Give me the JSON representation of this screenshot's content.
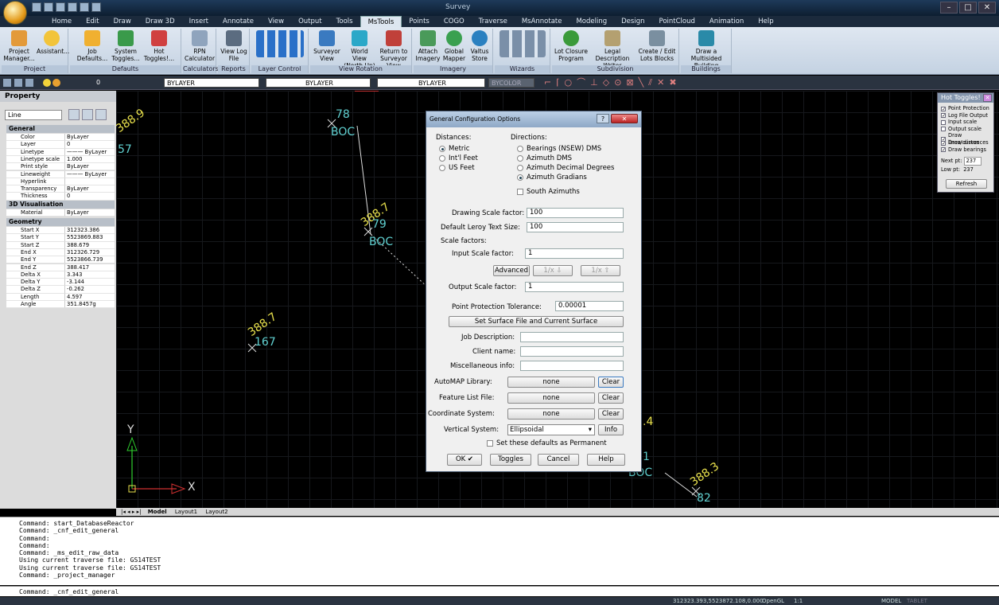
{
  "window": {
    "title": "Survey"
  },
  "ribbon_tabs": [
    "Home",
    "Edit",
    "Draw",
    "Draw 3D",
    "Insert",
    "Annotate",
    "View",
    "Output",
    "Tools",
    "MsTools",
    "Points",
    "COGO",
    "Traverse",
    "MsAnnotate",
    "Modeling",
    "Design",
    "PointCloud",
    "Animation",
    "Help"
  ],
  "ribbon_active_tab": "MsTools",
  "ribbon": {
    "project": {
      "title": "Project",
      "b1": "Project Manager...",
      "b2": "Assistant..."
    },
    "defaults": {
      "title": "Defaults",
      "b1": "Job Defaults...",
      "b2": "System Toggles...",
      "b3": "Hot Toggles!..."
    },
    "calculators": {
      "title": "Calculators",
      "b1": "RPN Calculator"
    },
    "reports": {
      "title": "Reports",
      "b1": "View Log File"
    },
    "layer": {
      "title": "Layer Control"
    },
    "viewrot": {
      "title": "View Rotation",
      "b1": "Surveyor View",
      "b2": "World View (North Up)",
      "b3": "Return to Surveyor View"
    },
    "imagery": {
      "title": "Imagery",
      "b1": "Attach Imagery",
      "b2": "Global Mapper",
      "b3": "Valtus Store"
    },
    "wizards": {
      "title": "Wizards"
    },
    "subdivision": {
      "title": "Subdivision",
      "b1": "Lot Closure Program",
      "b2": "Legal Description Writer",
      "b3": "Create / Edit Lots Blocks"
    },
    "buildings": {
      "title": "Buildings",
      "b1": "Draw a Multisided Building"
    }
  },
  "toolbar": {
    "layer": "0",
    "color": "BYLAYER",
    "linetype": "BYLAYER",
    "lineweight": "BYLAYER",
    "plotstyle": "BYCOLOR"
  },
  "properties": {
    "title": "Property",
    "selected": "Line",
    "general_title": "General",
    "general": [
      [
        "Color",
        "ByLayer"
      ],
      [
        "Layer",
        "0"
      ],
      [
        "Linetype",
        "——— ByLayer"
      ],
      [
        "Linetype scale",
        "1.000"
      ],
      [
        "Print style",
        "ByLayer"
      ],
      [
        "Lineweight",
        "——— ByLayer"
      ],
      [
        "Hyperlink",
        ""
      ],
      [
        "Transparency",
        "ByLayer"
      ],
      [
        "Thickness",
        "0"
      ]
    ],
    "vis_title": "3D Visualisation",
    "vis": [
      [
        "Material",
        "ByLayer"
      ]
    ],
    "geom_title": "Geometry",
    "geometry": [
      [
        "Start X",
        "312323.386"
      ],
      [
        "Start Y",
        "5523869.883"
      ],
      [
        "Start Z",
        "388.679"
      ],
      [
        "End X",
        "312326.729"
      ],
      [
        "End Y",
        "5523866.739"
      ],
      [
        "End Z",
        "388.417"
      ],
      [
        "Delta X",
        "3.343"
      ],
      [
        "Delta Y",
        "-3.144"
      ],
      [
        "Delta Z",
        "-0.262"
      ],
      [
        "Length",
        "4.597"
      ],
      [
        "Angle",
        "351.8457g"
      ]
    ]
  },
  "drawing": {
    "labels": [
      {
        "t": "388.9",
        "c": "yel"
      },
      {
        "t": "57",
        "c": "cyan"
      },
      {
        "t": "78",
        "c": "cyan"
      },
      {
        "t": "BOC",
        "c": "cyan"
      },
      {
        "t": "388.7",
        "c": "yel"
      },
      {
        "t": "79",
        "c": "cyan"
      },
      {
        "t": "BOC",
        "c": "cyan"
      },
      {
        "t": "388.7",
        "c": "yel"
      },
      {
        "t": "167",
        "c": "cyan"
      },
      {
        "t": "388.3",
        "c": "yel"
      },
      {
        "t": "82",
        "c": "cyan"
      },
      {
        "t": "BOC",
        "c": "cyan"
      },
      {
        "t": ".4",
        "c": "yel"
      },
      {
        "t": "1",
        "c": "cyan"
      }
    ],
    "ucs_x": "X",
    "ucs_y": "Y"
  },
  "layout_tabs": {
    "model": "Model",
    "l1": "Layout1",
    "l2": "Layout2"
  },
  "hot_toggles": {
    "title": "Hot Toggles!",
    "items": [
      [
        "Point Protection",
        true
      ],
      [
        "Log File Output",
        true
      ],
      [
        "Input scale",
        false
      ],
      [
        "Output scale",
        false
      ],
      [
        "Draw lines/curves",
        true
      ],
      [
        "Draw distances",
        true
      ],
      [
        "Draw bearings",
        true
      ]
    ],
    "next_pt_label": "Next pt:",
    "next_pt": "237",
    "low_pt_label": "Low pt:",
    "low_pt": "237",
    "refresh": "Refresh"
  },
  "dialog": {
    "title": "General Configuration Options",
    "distances_label": "Distances:",
    "distances": [
      "Metric",
      "Int'l Feet",
      "US Feet"
    ],
    "directions_label": "Directions:",
    "directions": [
      "Bearings (NSEW) DMS",
      "Azimuth DMS",
      "Azimuth Decimal Degrees",
      "Azimuth Gradians"
    ],
    "south_az": "South Azimuths",
    "dsf_label": "Drawing Scale factor:",
    "dsf": "100",
    "leroy_label": "Default Leroy Text Size:",
    "leroy": "100",
    "scale_label": "Scale factors:",
    "isf_label": "Input Scale factor:",
    "isf": "1",
    "advanced": "Advanced",
    "inv1": "1/x ⇩",
    "inv2": "1/x ⇧",
    "osf_label": "Output Scale factor:",
    "osf": "1",
    "ppt_label": "Point Protection Tolerance:",
    "ppt": "0.00001",
    "surface_btn": "Set Surface File and Current Surface",
    "job_label": "Job Description:",
    "client_label": "Client name:",
    "misc_label": "Miscellaneous info:",
    "automap_label": "AutoMAP Library:",
    "automap": "none",
    "feature_label": "Feature List File:",
    "feature": "none",
    "coord_label": "Coordinate System:",
    "coord": "none",
    "clear": "Clear",
    "vert_label": "Vertical System:",
    "vert": "Ellipsoidal",
    "info": "Info",
    "permanent": "Set these defaults as Permanent",
    "ok": "OK ✔",
    "toggles": "Toggles",
    "cancel": "Cancel",
    "help": "Help"
  },
  "command_history": [
    "Command: start_DatabaseReactor",
    "Command: _cnf_edit_general",
    "Command:",
    "Command:",
    "Command: _ms_edit_raw_data",
    "Using current traverse file: GS14TEST",
    "Using current traverse file: GS14TEST",
    "Command: _project_manager"
  ],
  "command_line": "Command: _cnf_edit_general",
  "status": {
    "coords": "312323.393,5523872.108,0.000",
    "render": "OpenGL",
    "scale": "1:1",
    "model": "MODEL",
    "tablet": "TABLET"
  }
}
